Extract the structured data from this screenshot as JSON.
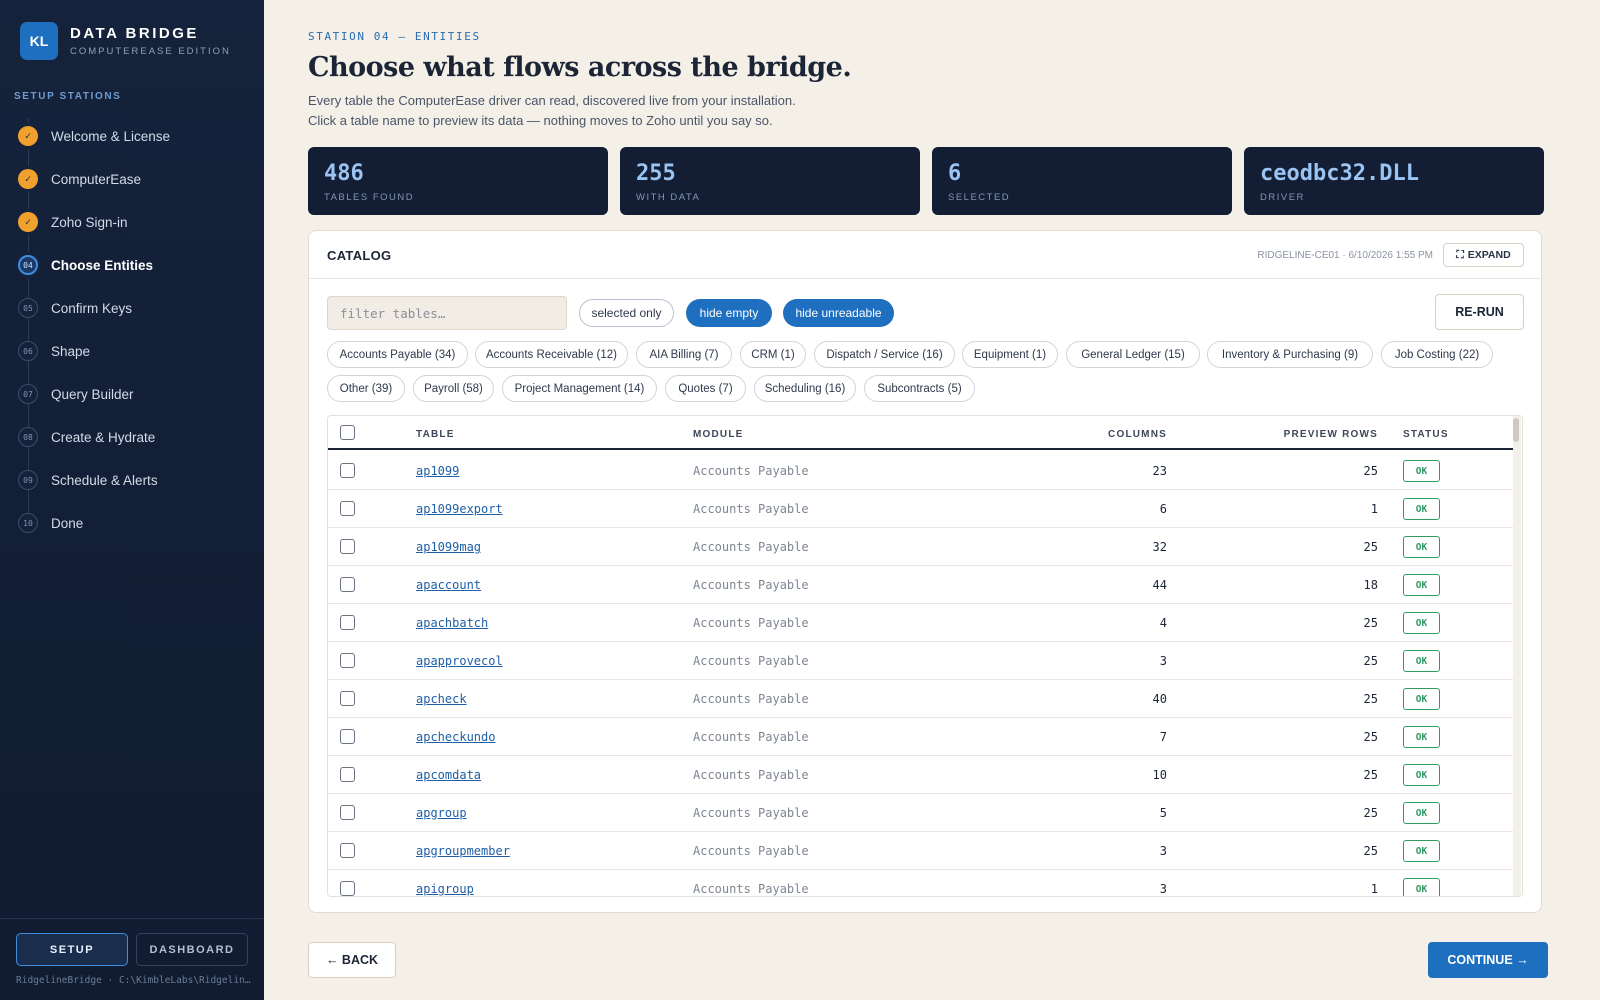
{
  "brand": {
    "logo": "KL",
    "title": "DATA BRIDGE",
    "subtitle": "COMPUTEREASE EDITION"
  },
  "sidebar": {
    "section_label": "SETUP STATIONS",
    "steps": [
      {
        "marker": "✓",
        "label": "Welcome & License",
        "state": "done"
      },
      {
        "marker": "✓",
        "label": "ComputerEase",
        "state": "done"
      },
      {
        "marker": "✓",
        "label": "Zoho Sign-in",
        "state": "done"
      },
      {
        "marker": "04",
        "label": "Choose Entities",
        "state": "active"
      },
      {
        "marker": "05",
        "label": "Confirm Keys",
        "state": "todo"
      },
      {
        "marker": "06",
        "label": "Shape",
        "state": "todo"
      },
      {
        "marker": "07",
        "label": "Query Builder",
        "state": "todo"
      },
      {
        "marker": "08",
        "label": "Create & Hydrate",
        "state": "todo"
      },
      {
        "marker": "09",
        "label": "Schedule & Alerts",
        "state": "todo"
      },
      {
        "marker": "10",
        "label": "Done",
        "state": "todo"
      }
    ],
    "mode_setup": "SETUP",
    "mode_dashboard": "DASHBOARD",
    "footer_path": "RidgelineBridge · C:\\KimbleLabs\\Ridgelin…"
  },
  "header": {
    "eyebrow": "STATION 04 — ENTITIES",
    "title": "Choose what flows across the bridge.",
    "subtitle_line1": "Every table the ComputerEase driver can read, discovered live from your installation.",
    "subtitle_line2": "Click a table name to preview its data — nothing moves to Zoho until you say so."
  },
  "stats": [
    {
      "value": "486",
      "label": "TABLES FOUND"
    },
    {
      "value": "255",
      "label": "WITH DATA"
    },
    {
      "value": "6",
      "label": "SELECTED"
    },
    {
      "value": "ceodbc32.DLL",
      "label": "DRIVER"
    }
  ],
  "catalog": {
    "title": "CATALOG",
    "meta": "RIDGELINE-CE01 · 6/10/2026 1:55 PM",
    "expand_label": "EXPAND",
    "filter_placeholder": "filter tables…",
    "toggles": {
      "selected_only": "selected only",
      "hide_empty": "hide empty",
      "hide_unreadable": "hide unreadable"
    },
    "rerun_label": "RE-RUN",
    "categories": [
      "Accounts Payable (34)",
      "Accounts Receivable (12)",
      "AIA Billing (7)",
      "CRM (1)",
      "Dispatch / Service (16)",
      "Equipment (1)",
      "General Ledger (15)",
      "Inventory & Purchasing (9)",
      "Job Costing (22)",
      "Other (39)",
      "Payroll (58)",
      "Project Management (14)",
      "Quotes (7)",
      "Scheduling (16)",
      "Subcontracts (5)"
    ],
    "columns": {
      "table": "TABLE",
      "module": "MODULE",
      "columns": "COLUMNS",
      "preview_rows": "PREVIEW ROWS",
      "status": "STATUS"
    },
    "rows": [
      {
        "table": "ap1099",
        "module": "Accounts Payable",
        "columns": "23",
        "preview_rows": "25",
        "status": "OK"
      },
      {
        "table": "ap1099export",
        "module": "Accounts Payable",
        "columns": "6",
        "preview_rows": "1",
        "status": "OK"
      },
      {
        "table": "ap1099mag",
        "module": "Accounts Payable",
        "columns": "32",
        "preview_rows": "25",
        "status": "OK"
      },
      {
        "table": "apaccount",
        "module": "Accounts Payable",
        "columns": "44",
        "preview_rows": "18",
        "status": "OK"
      },
      {
        "table": "apachbatch",
        "module": "Accounts Payable",
        "columns": "4",
        "preview_rows": "25",
        "status": "OK"
      },
      {
        "table": "apapprovecol",
        "module": "Accounts Payable",
        "columns": "3",
        "preview_rows": "25",
        "status": "OK"
      },
      {
        "table": "apcheck",
        "module": "Accounts Payable",
        "columns": "40",
        "preview_rows": "25",
        "status": "OK"
      },
      {
        "table": "apcheckundo",
        "module": "Accounts Payable",
        "columns": "7",
        "preview_rows": "25",
        "status": "OK"
      },
      {
        "table": "apcomdata",
        "module": "Accounts Payable",
        "columns": "10",
        "preview_rows": "25",
        "status": "OK"
      },
      {
        "table": "apgroup",
        "module": "Accounts Payable",
        "columns": "5",
        "preview_rows": "25",
        "status": "OK"
      },
      {
        "table": "apgroupmember",
        "module": "Accounts Payable",
        "columns": "3",
        "preview_rows": "25",
        "status": "OK"
      },
      {
        "table": "apigroup",
        "module": "Accounts Payable",
        "columns": "3",
        "preview_rows": "1",
        "status": "OK"
      }
    ]
  },
  "footer": {
    "back_label": "← BACK",
    "continue_label": "CONTINUE →"
  },
  "colors": {
    "accent": "#1f6fc0",
    "done": "#f0a02c",
    "ok": "#2f9a62",
    "sidebar": "#15223b"
  }
}
